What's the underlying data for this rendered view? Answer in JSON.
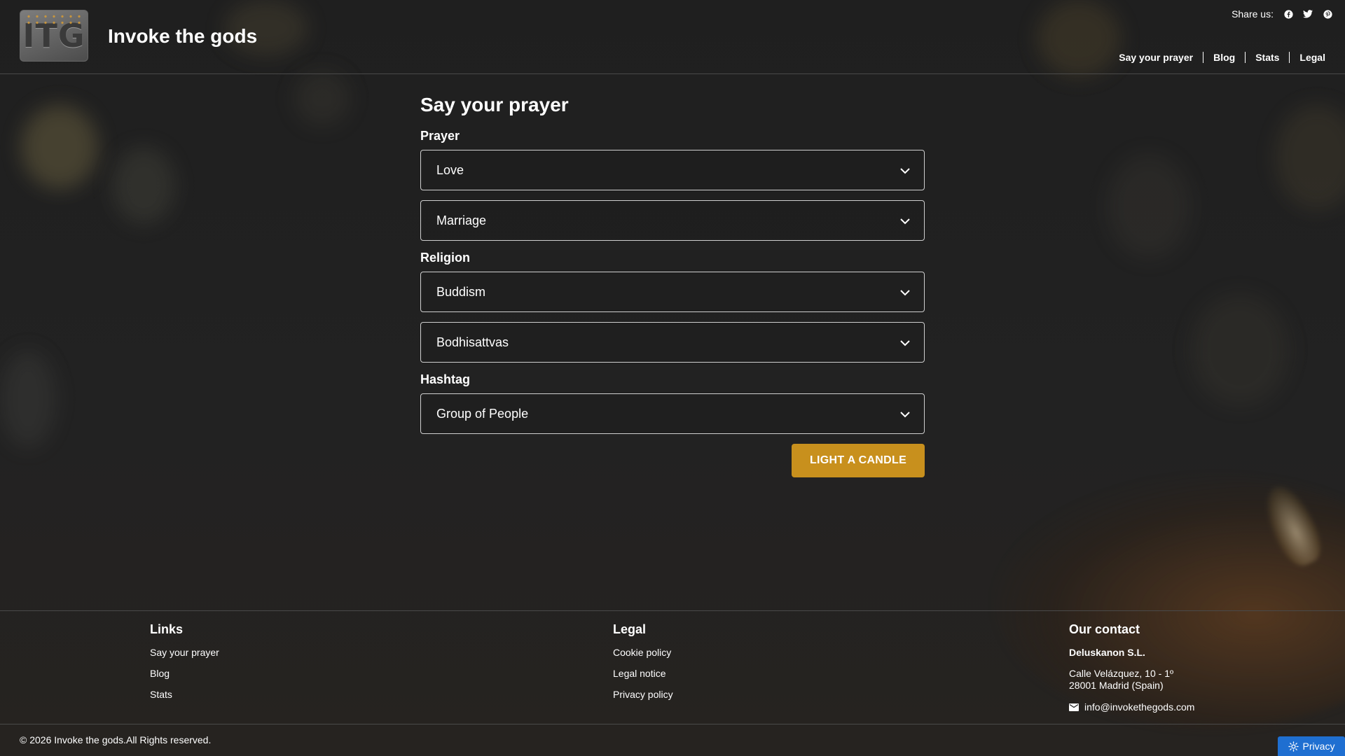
{
  "header": {
    "logo_text": "ITG",
    "site_title": "Invoke the gods",
    "share_label": "Share us:",
    "share_icons": [
      "facebook-icon",
      "twitter-icon",
      "pinterest-icon"
    ],
    "nav": [
      "Say your prayer",
      "Blog",
      "Stats",
      "Legal"
    ]
  },
  "main": {
    "title": "Say your prayer",
    "prayer_label": "Prayer",
    "prayer_value": "Love",
    "prayer_sub_value": "Marriage",
    "religion_label": "Religion",
    "religion_value": "Buddism",
    "religion_sub_value": "Bodhisattvas",
    "hashtag_label": "Hashtag",
    "hashtag_value": "Group of People",
    "submit_label": "LIGHT A CANDLE"
  },
  "footer": {
    "links_title": "Links",
    "links": [
      "Say your prayer",
      "Blog",
      "Stats"
    ],
    "legal_title": "Legal",
    "legal": [
      "Cookie policy",
      "Legal notice",
      "Privacy policy"
    ],
    "contact_title": "Our contact",
    "company": "Deluskanon S.L.",
    "address_line1": "Calle Velázquez, 10 - 1º",
    "address_line2": "28001 Madrid (Spain)",
    "email": "info@invokethegods.com",
    "copyright": "© 2026 Invoke the gods.All Rights reserved.",
    "privacy_label": "Privacy"
  },
  "colors": {
    "accent": "#c8901d",
    "privacy": "#1f6fd1",
    "background": "#1d1d1d"
  }
}
